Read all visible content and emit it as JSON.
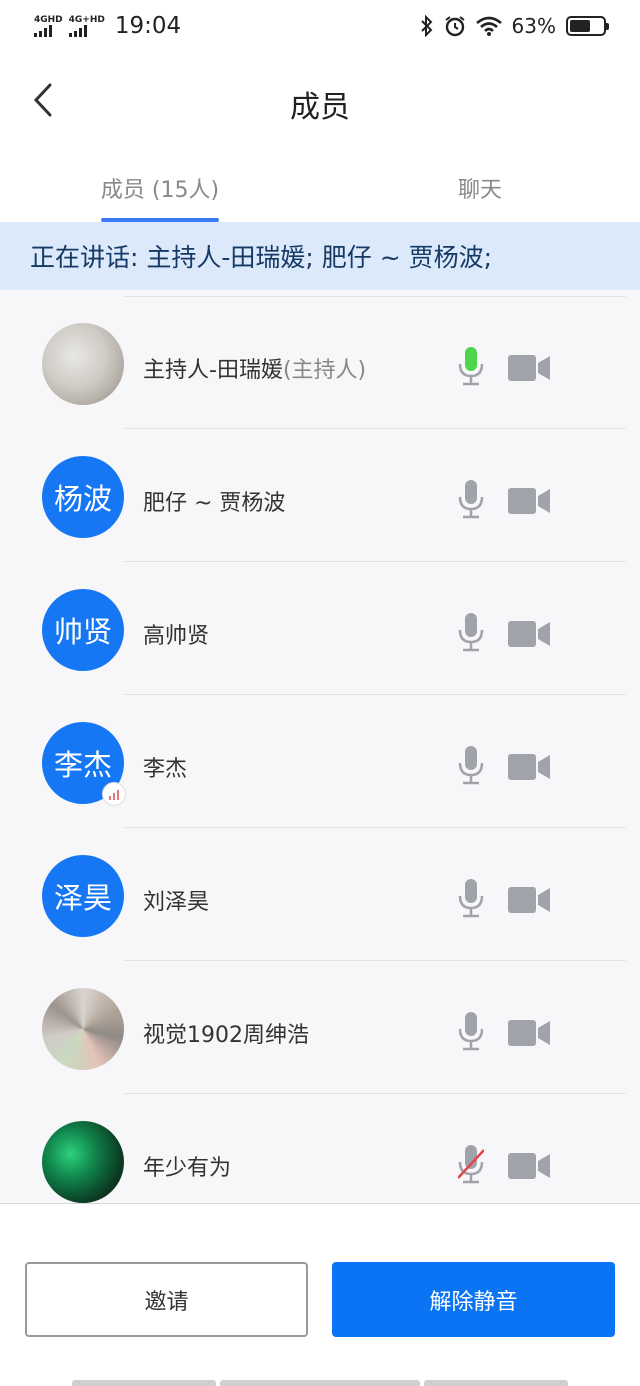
{
  "status_bar": {
    "net1": "4GHD",
    "net2": "4G+HD",
    "time": "19:04",
    "battery": "63%",
    "battery_level": 0.63
  },
  "nav": {
    "title": "成员"
  },
  "tabs": [
    {
      "label": "成员 (15人)",
      "active": true
    },
    {
      "label": "聊天",
      "active": false
    }
  ],
  "speaking": "正在讲话: 主持人-田瑞媛; 肥仔 ~ 贾杨波;",
  "members": [
    {
      "avatar_type": "photo1",
      "avatar_text": "",
      "name": "主持人-田瑞媛",
      "role": "(主持人)",
      "mic": "speaking",
      "signal_badge": false
    },
    {
      "avatar_type": "text",
      "avatar_text": "杨波",
      "name": "肥仔 ~ 贾杨波",
      "role": "",
      "mic": "on",
      "signal_badge": false
    },
    {
      "avatar_type": "text",
      "avatar_text": "帅贤",
      "name": "高帅贤",
      "role": "",
      "mic": "on",
      "signal_badge": false
    },
    {
      "avatar_type": "text",
      "avatar_text": "李杰",
      "name": "李杰",
      "role": "",
      "mic": "on",
      "signal_badge": true
    },
    {
      "avatar_type": "text",
      "avatar_text": "泽昊",
      "name": "刘泽昊",
      "role": "",
      "mic": "on",
      "signal_badge": false
    },
    {
      "avatar_type": "photo2",
      "avatar_text": "",
      "name": "视觉1902周绅浩",
      "role": "",
      "mic": "on",
      "signal_badge": false
    },
    {
      "avatar_type": "photo3",
      "avatar_text": "",
      "name": "年少有为",
      "role": "",
      "mic": "muted",
      "signal_badge": false
    }
  ],
  "buttons": {
    "invite": "邀请",
    "unmute": "解除静音"
  },
  "colors": {
    "accent": "#0b74f5",
    "avatar_bg": "#1677f5",
    "mic_speaking": "#4cd64c",
    "icon_gray": "#a0a3aa",
    "muted_slash": "#e0464a",
    "banner_bg": "#dce9fb"
  }
}
